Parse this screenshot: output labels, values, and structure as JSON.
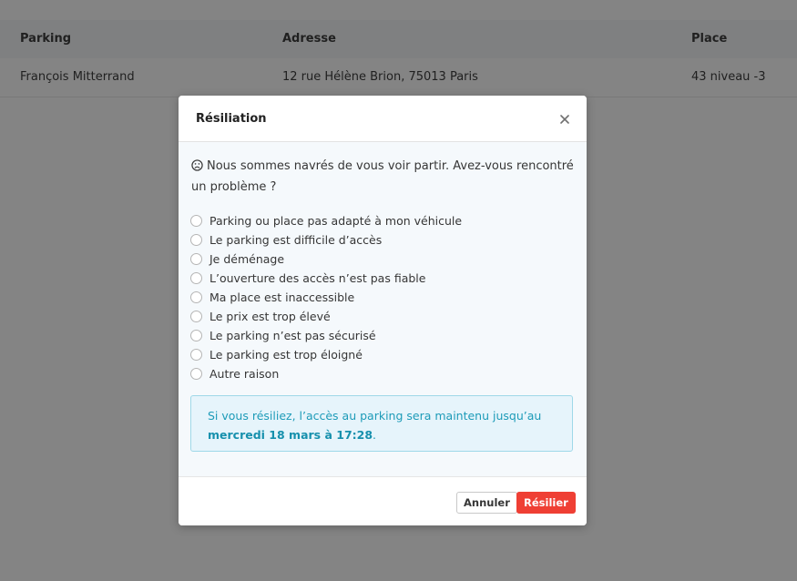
{
  "table": {
    "headers": [
      "Parking",
      "Adresse",
      "Place"
    ],
    "rows": [
      [
        "François Mitterrand",
        "12 rue Hélène Brion, 75013 Paris",
        "43 niveau -3"
      ]
    ]
  },
  "modal": {
    "title": "Résiliation",
    "close_icon": "close-icon",
    "intro_icon": "sad-face-icon",
    "intro": "Nous sommes navrés de vous voir partir. Avez-vous rencontré un problème ?",
    "options": [
      "Parking ou place pas adapté à mon véhicule",
      "Le parking est difficile d’accès",
      "Je déménage",
      "L’ouverture des accès n’est pas fiable",
      "Ma place est inaccessible",
      "Le prix est trop élevé",
      "Le parking n’est pas sécurisé",
      "Le parking est trop éloigné",
      "Autre raison"
    ],
    "notice_text": "Si vous résiliez, l’accès au parking sera maintenu jusqu’au",
    "notice_date": "mercredi 18 mars à 17:28",
    "notice_end": ".",
    "cancel_label": "Annuler",
    "submit_label": "Résilier"
  },
  "colors": {
    "danger": "#ef3f34",
    "info_text": "#1d9bb8",
    "info_bg": "#e6f4fb",
    "info_border": "#9fd8e8"
  }
}
